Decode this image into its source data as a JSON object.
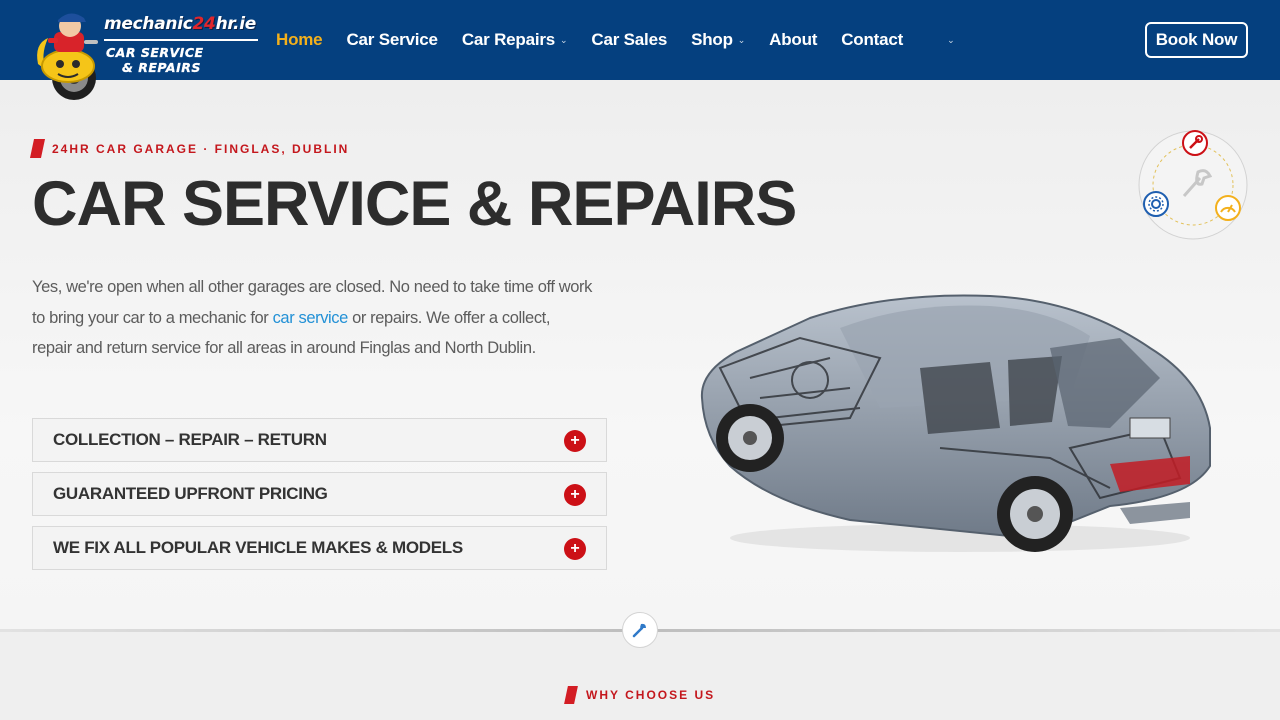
{
  "header": {
    "logo": {
      "title_main": "mechanic",
      "title_accent": "24",
      "title_end": "hr.ie",
      "sub1": "CAR SERVICE",
      "sub2": "& REPAIRS"
    },
    "nav": [
      {
        "label": "Home",
        "active": true
      },
      {
        "label": "Car Service"
      },
      {
        "label": "Car Repairs",
        "dropdown": true
      },
      {
        "label": "Car Sales"
      },
      {
        "label": "Shop",
        "dropdown": true
      },
      {
        "label": "About"
      },
      {
        "label": "Contact"
      }
    ],
    "book_button": "Book Now"
  },
  "hero": {
    "eyebrow": "24HR CAR GARAGE · FINGLAS, DUBLIN",
    "title": "CAR SERVICE & REPAIRS",
    "text_before": "Yes, we're open when all other garages are closed. No need to take time off work to bring your car to a mechanic for ",
    "text_link": "car service",
    "text_after": " or repairs. We offer a collect, repair and return service for all areas in around Finglas and North Dublin.",
    "accordion": [
      {
        "label": "COLLECTION – REPAIR – RETURN"
      },
      {
        "label": "GUARANTEED UPFRONT PRICING"
      },
      {
        "label": "WE FIX ALL POPULAR VEHICLE MAKES & MODELS"
      }
    ],
    "accordion_plus": "+"
  },
  "section": {
    "eyebrow": "WHY CHOOSE US"
  },
  "icons": {
    "divider": "wrench-icon",
    "orbit": [
      "wrench-icon",
      "gear-icon",
      "gauge-icon"
    ]
  },
  "colors": {
    "header_bg": "#05407f",
    "nav_active": "#f3b01c",
    "accent_red": "#d31d24",
    "link_blue": "#2391d6",
    "title_dark": "#2d2d2d"
  }
}
